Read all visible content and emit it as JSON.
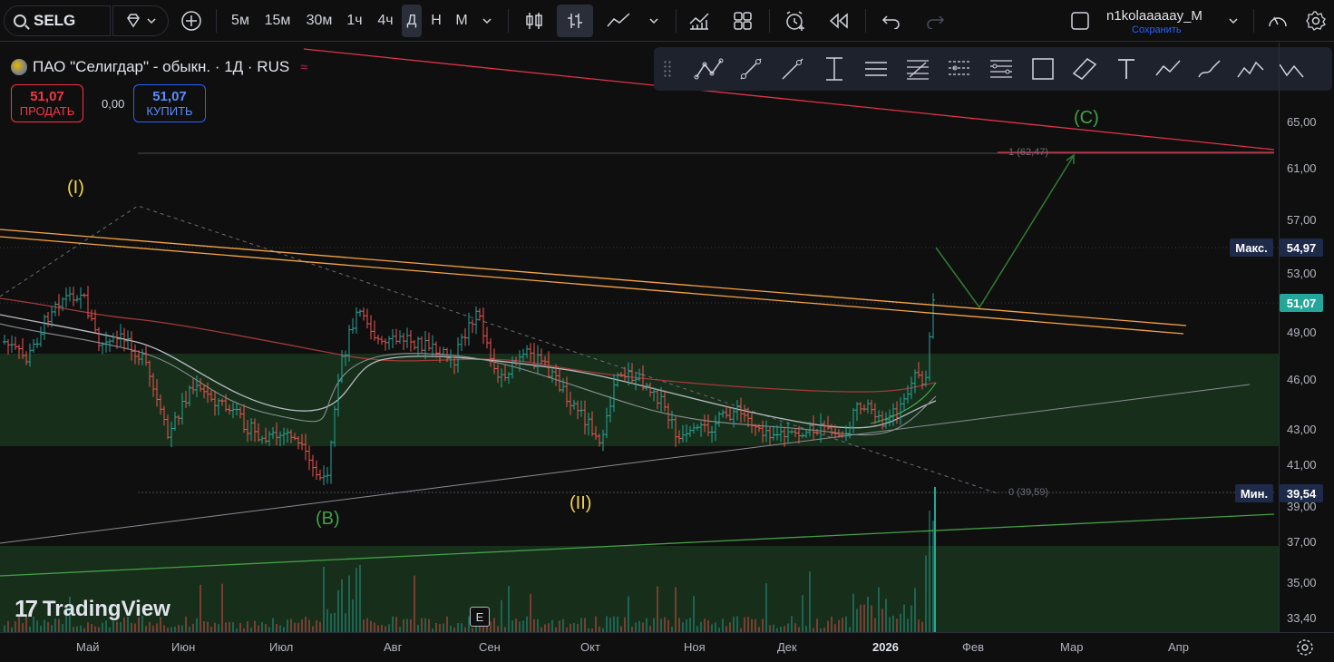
{
  "symbol": {
    "ticker": "SELG"
  },
  "timeframes": [
    "5м",
    "15м",
    "30м",
    "1ч",
    "4ч",
    "Д",
    "Н",
    "М"
  ],
  "active_timeframe": "Д",
  "user": {
    "name": "n1kolaaaaay_M",
    "save_label": "Сохранить"
  },
  "legend": {
    "title": "ПАО \"Селигдар\" - обыкн. · 1Д · RUS"
  },
  "trade": {
    "sell_price": "51,07",
    "sell_label": "ПРОДАТЬ",
    "spread": "0,00",
    "buy_price": "51,07",
    "buy_label": "КУПИТЬ"
  },
  "price_axis": {
    "ticks": [
      "65,00",
      "61,00",
      "57,00",
      "53,00",
      "49,00",
      "46,00",
      "43,00",
      "41,00",
      "39,00",
      "37,00",
      "35,00",
      "33,40"
    ]
  },
  "badges": {
    "max_label": "Макс.",
    "max_value": "54,97",
    "current": "51,07",
    "min_label": "Мин.",
    "min_value": "39,54"
  },
  "time_axis": {
    "ticks": [
      "Май",
      "Июн",
      "Июл",
      "Авг",
      "Сен",
      "Окт",
      "Ноя",
      "Дек",
      "2026",
      "Фев",
      "Мар",
      "Апр"
    ]
  },
  "waves": {
    "w1": "(I)",
    "w2": "(II)",
    "wb": "(B)",
    "wc": "(C)"
  },
  "fib": {
    "top": "1 (62,47)",
    "bottom": "0 (39,59)"
  },
  "branding": {
    "logo_text": "TradingView",
    "event_marker": "E"
  },
  "colors": {
    "up": "#26a69a",
    "down": "#ef5350",
    "accent": "#2962ff",
    "zone": "#1b3a1f",
    "trend_orange": "#f7a541",
    "trend_red": "#e0334a",
    "wave_green": "#43a047",
    "wave_yellow": "#f5d547"
  }
}
